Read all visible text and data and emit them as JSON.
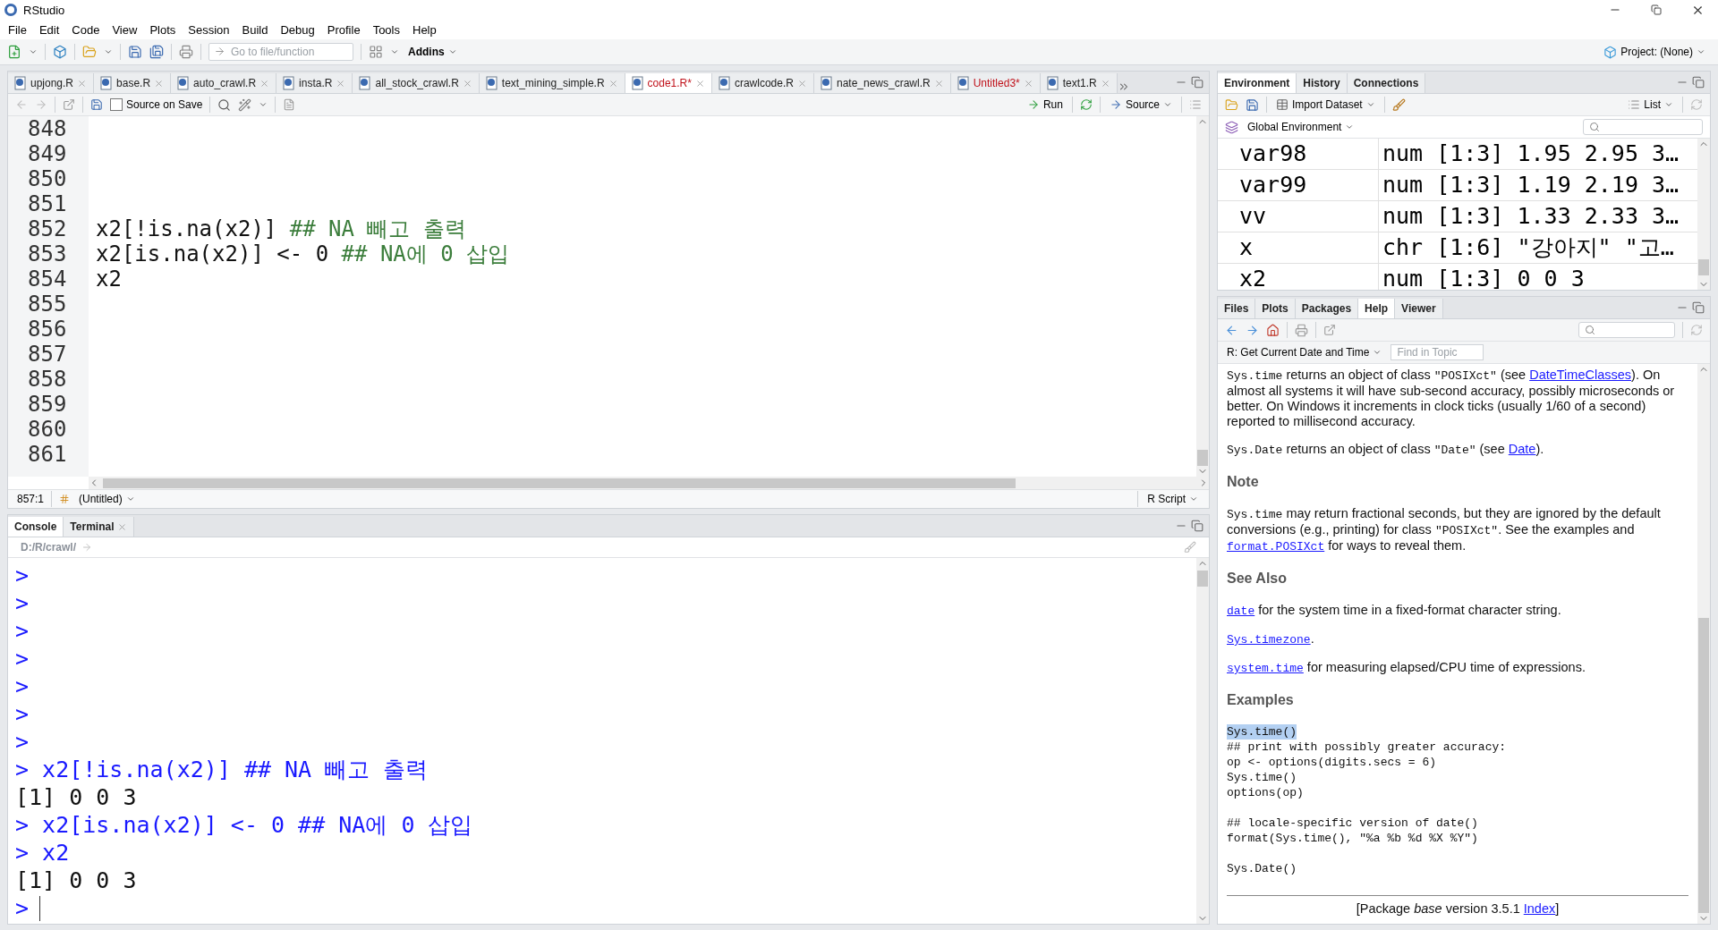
{
  "window": {
    "title": "RStudio"
  },
  "menu": [
    "File",
    "Edit",
    "Code",
    "View",
    "Plots",
    "Session",
    "Build",
    "Debug",
    "Profile",
    "Tools",
    "Help"
  ],
  "toolbar": {
    "goto_placeholder": "Go to file/function",
    "addins": "Addins",
    "project": "Project: (None)"
  },
  "editor": {
    "tabs": [
      {
        "label": "upjong.R",
        "selected": false,
        "modified": false
      },
      {
        "label": "base.R",
        "selected": false,
        "modified": false
      },
      {
        "label": "auto_crawl.R",
        "selected": false,
        "modified": false
      },
      {
        "label": "insta.R",
        "selected": false,
        "modified": false
      },
      {
        "label": "all_stock_crawl.R",
        "selected": false,
        "modified": false
      },
      {
        "label": "text_mining_simple.R",
        "selected": false,
        "modified": false
      },
      {
        "label": "code1.R*",
        "selected": true,
        "modified": true
      },
      {
        "label": "crawlcode.R",
        "selected": false,
        "modified": false
      },
      {
        "label": "nate_news_crawl.R",
        "selected": false,
        "modified": false
      },
      {
        "label": "Untitled3*",
        "selected": false,
        "modified": true
      },
      {
        "label": "text1.R",
        "selected": false,
        "modified": false
      }
    ],
    "source_on_save": {
      "label": "Source on Save",
      "checked": false
    },
    "run": "Run",
    "source": "Source",
    "lines": [
      {
        "number": "848"
      },
      {
        "number": "849"
      },
      {
        "number": "850"
      },
      {
        "number": "851"
      },
      {
        "number": "852",
        "code": "x2[!is.na(x2)] ",
        "comment": "## NA 빼고 출력"
      },
      {
        "number": "853",
        "code": "x2[is.na(x2)] <- 0 ",
        "comment": "## NA에 0 삽입"
      },
      {
        "number": "854",
        "code": "x2"
      },
      {
        "number": "855"
      },
      {
        "number": "856"
      },
      {
        "number": "857"
      },
      {
        "number": "858"
      },
      {
        "number": "859"
      },
      {
        "number": "860"
      },
      {
        "number": "861"
      }
    ],
    "cursor": "857:1",
    "scope": "(Untitled)",
    "file_type": "R Script"
  },
  "console": {
    "tabs": [
      {
        "label": "Console",
        "selected": true,
        "closable": false
      },
      {
        "label": "Terminal",
        "selected": false,
        "closable": true
      }
    ],
    "path": "D:/R/crawl/",
    "lines": [
      {
        "kind": "input",
        "prompt": ">"
      },
      {
        "kind": "input",
        "prompt": ">"
      },
      {
        "kind": "input",
        "prompt": ">"
      },
      {
        "kind": "input",
        "prompt": ">"
      },
      {
        "kind": "input",
        "prompt": ">"
      },
      {
        "kind": "input",
        "prompt": ">"
      },
      {
        "kind": "input",
        "prompt": ">"
      },
      {
        "kind": "input",
        "prompt": ">",
        "text": "x2[!is.na(x2)] ## NA 빼고 출력"
      },
      {
        "kind": "output",
        "text": "[1] 0 0 3"
      },
      {
        "kind": "input",
        "prompt": ">",
        "text": "x2[is.na(x2)] <- 0 ## NA에 0 삽입"
      },
      {
        "kind": "input",
        "prompt": ">",
        "text": "x2"
      },
      {
        "kind": "output",
        "text": "[1] 0 0 3"
      },
      {
        "kind": "input",
        "prompt": ">"
      }
    ]
  },
  "environment": {
    "tabs": [
      {
        "label": "Environment",
        "selected": true
      },
      {
        "label": "History",
        "selected": false
      },
      {
        "label": "Connections",
        "selected": false
      }
    ],
    "import": "Import Dataset",
    "view": "List",
    "scope": "Global Environment",
    "rows": [
      {
        "name": "var98",
        "value": "num [1:3] 1.95 2.95 3…"
      },
      {
        "name": "var99",
        "value": "num [1:3] 1.19 2.19 3…"
      },
      {
        "name": "vv",
        "value": "num [1:3] 1.33 2.33 3…"
      },
      {
        "name": "x",
        "value": "chr [1:6] \"강아지\" \"고…"
      },
      {
        "name": "x2",
        "value": "num [1:3] 0 0 3"
      }
    ]
  },
  "help_pane": {
    "tabs": [
      {
        "label": "Files",
        "selected": false
      },
      {
        "label": "Plots",
        "selected": false
      },
      {
        "label": "Packages",
        "selected": false
      },
      {
        "label": "Help",
        "selected": true
      },
      {
        "label": "Viewer",
        "selected": false
      }
    ],
    "topic": "R: Get Current Date and Time",
    "find_placeholder": "Find in Topic",
    "blocks": [
      {
        "kind": "para",
        "parts": [
          {
            "kind": "code",
            "text": "Sys.time"
          },
          {
            "kind": "text",
            "text": " returns an object of class "
          },
          {
            "kind": "code",
            "text": "\"POSIXct\""
          },
          {
            "kind": "text",
            "text": " (see "
          },
          {
            "kind": "link",
            "text": "DateTimeClasses"
          },
          {
            "kind": "text",
            "text": "). On almost all systems it will have sub-second accuracy, possibly microseconds or better. On Windows it increments in clock ticks (usually 1/60 of a second) reported to millisecond accuracy."
          }
        ]
      },
      {
        "kind": "para",
        "parts": [
          {
            "kind": "code",
            "text": "Sys.Date"
          },
          {
            "kind": "text",
            "text": " returns an object of class "
          },
          {
            "kind": "code",
            "text": "\"Date\""
          },
          {
            "kind": "text",
            "text": " (see "
          },
          {
            "kind": "link",
            "text": "Date"
          },
          {
            "kind": "text",
            "text": ")."
          }
        ]
      },
      {
        "kind": "heading",
        "text": "Note"
      },
      {
        "kind": "para",
        "parts": [
          {
            "kind": "code",
            "text": "Sys.time"
          },
          {
            "kind": "text",
            "text": " may return fractional seconds, but they are ignored by the default conversions (e.g., printing) for class "
          },
          {
            "kind": "code",
            "text": "\"POSIXct\""
          },
          {
            "kind": "text",
            "text": ". See the examples and "
          },
          {
            "kind": "codelink",
            "text": "format.POSIXct"
          },
          {
            "kind": "text",
            "text": " for ways to reveal them."
          }
        ]
      },
      {
        "kind": "heading",
        "text": "See Also"
      },
      {
        "kind": "para",
        "parts": [
          {
            "kind": "codelink",
            "text": "date"
          },
          {
            "kind": "text",
            "text": " for the system time in a fixed-format character string."
          }
        ]
      },
      {
        "kind": "para",
        "parts": [
          {
            "kind": "codelink",
            "text": "Sys.timezone"
          },
          {
            "kind": "text",
            "text": "."
          }
        ]
      },
      {
        "kind": "para",
        "parts": [
          {
            "kind": "codelink",
            "text": "system.time"
          },
          {
            "kind": "text",
            "text": " for measuring elapsed/CPU time of expressions."
          }
        ]
      },
      {
        "kind": "heading",
        "text": "Examples"
      },
      {
        "kind": "example",
        "groups": [
          [
            {
              "text": "Sys.time()",
              "selected": true
            },
            {
              "text": "## print with possibly greater accuracy:",
              "selected": false
            },
            {
              "text": "op <- options(digits.secs = 6)",
              "selected": false
            },
            {
              "text": "Sys.time()",
              "selected": false
            },
            {
              "text": "options(op)",
              "selected": false
            }
          ],
          [
            {
              "text": "## locale-specific version of date()",
              "selected": false
            },
            {
              "text": "format(Sys.time(), \"%a %b %d %X %Y\")",
              "selected": false
            }
          ],
          [
            {
              "text": "Sys.Date()",
              "selected": false
            }
          ]
        ]
      }
    ],
    "footer": {
      "text": "[Package *base* version 3.5.1 ",
      "link": "Index",
      "end": "]"
    }
  }
}
